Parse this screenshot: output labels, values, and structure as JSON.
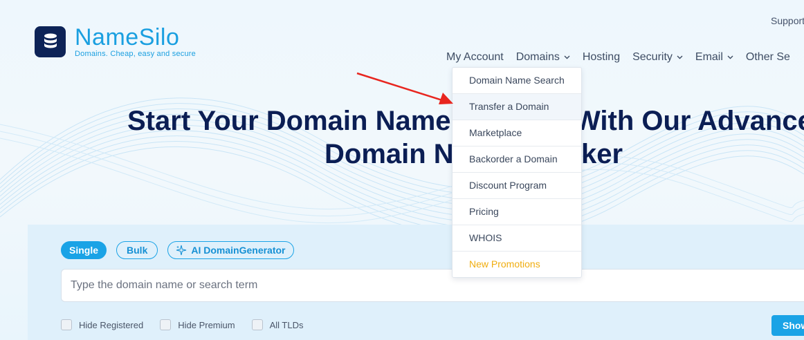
{
  "brand": {
    "name": "NameSilo",
    "tagline": "Domains. Cheap, easy and secure",
    "logo_icon": "database-icon",
    "color_primary": "#1a9fe0",
    "color_dark": "#0d2357"
  },
  "header": {
    "support_label": "Support"
  },
  "nav": {
    "items": [
      {
        "label": "My Account",
        "has_dropdown": false
      },
      {
        "label": "Domains",
        "has_dropdown": true
      },
      {
        "label": "Hosting",
        "has_dropdown": false
      },
      {
        "label": "Security",
        "has_dropdown": true
      },
      {
        "label": "Email",
        "has_dropdown": true
      },
      {
        "label": "Other Se",
        "has_dropdown": false
      }
    ]
  },
  "domains_menu": {
    "items": [
      {
        "label": "Domain Name Search"
      },
      {
        "label": "Transfer a Domain",
        "state": "hovered"
      },
      {
        "label": "Marketplace"
      },
      {
        "label": "Backorder a Domain"
      },
      {
        "label": "Discount Program"
      },
      {
        "label": "Pricing"
      },
      {
        "label": "WHOIS"
      },
      {
        "label": "New Promotions",
        "color": "#f0ad0f"
      }
    ]
  },
  "hero": {
    "line1_start": "Start Your Domain Name",
    "line1_end": "With Our Advance",
    "line2_start": "Domain N",
    "line2_end": "ker"
  },
  "search": {
    "tabs": [
      {
        "label": "Single",
        "active": true
      },
      {
        "label": "Bulk",
        "active": false
      },
      {
        "label": "AI DomainGenerator",
        "active": false,
        "icon": "sparkle-icon"
      }
    ],
    "placeholder": "Type the domain name or search term",
    "value": "",
    "filters": [
      {
        "label": "Hide Registered",
        "checked": false
      },
      {
        "label": "Hide Premium",
        "checked": false
      },
      {
        "label": "All TLDs",
        "checked": false
      }
    ],
    "show_button_label": "Show"
  },
  "annotation": {
    "type": "red-arrow-icon",
    "color": "#e8261f",
    "points_to": "Transfer a Domain"
  }
}
